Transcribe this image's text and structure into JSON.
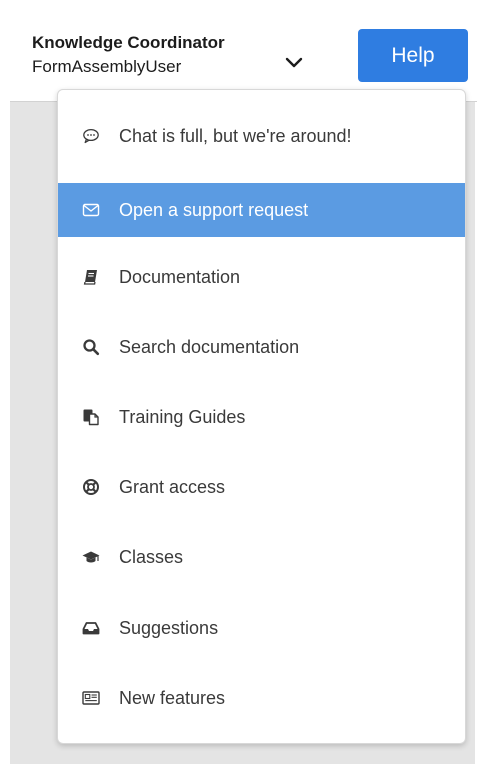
{
  "header": {
    "user_name": "Knowledge Coordinator",
    "user_role": "FormAssemblyUser",
    "help_label": "Help"
  },
  "menu": {
    "items": [
      {
        "label": "Chat is full, but we're around!",
        "icon": "chat-bubble-icon",
        "active": false
      },
      {
        "label": "Open a support request",
        "icon": "envelope-icon",
        "active": true
      },
      {
        "label": "Documentation",
        "icon": "book-icon",
        "active": false
      },
      {
        "label": "Search documentation",
        "icon": "search-icon",
        "active": false
      },
      {
        "label": "Training Guides",
        "icon": "copy-document-icon",
        "active": false
      },
      {
        "label": "Grant access",
        "icon": "life-ring-icon",
        "active": false
      },
      {
        "label": "Classes",
        "icon": "graduation-cap-icon",
        "active": false
      },
      {
        "label": "Suggestions",
        "icon": "inbox-icon",
        "active": false
      },
      {
        "label": "New features",
        "icon": "newspaper-icon",
        "active": false
      }
    ]
  },
  "colors": {
    "help_button": "#2f7de1",
    "active_item": "#5b9be2",
    "page_background": "#e4e4e4"
  }
}
